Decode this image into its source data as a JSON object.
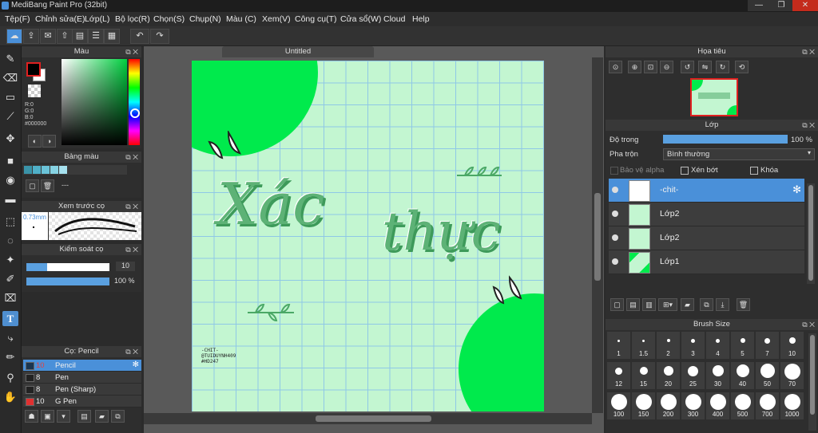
{
  "window": {
    "title": "MediBang Paint Pro (32bit)",
    "min": "—",
    "max": "❐",
    "close": "✕"
  },
  "menu": [
    "Tệp(F)",
    "Chỉnh sửa(E)",
    "Lớp(L)",
    "Bộ lọc(R)",
    "Chọn(S)",
    "Chụp(N)",
    "Màu (C)",
    "Xem(V)",
    "Công cụ(T)",
    "Cửa sổ(W)",
    "Cloud",
    "Help"
  ],
  "color_panel": {
    "title": "Màu",
    "r": "R:0",
    "g": "G:0",
    "b": "B:0",
    "hex": "#000000"
  },
  "palette_panel": {
    "title": "Bảng màu",
    "swatches": [
      "#3a93a8",
      "#4fb0c8",
      "#6ac3d8",
      "#86d3e3",
      "#a6e1ee"
    ],
    "value": "---"
  },
  "brush_preview": {
    "title": "Xem trước cọ",
    "size": "0.73mm"
  },
  "brush_control": {
    "title": "Kiểm soát cọ",
    "size_value": "10",
    "opacity_value": "100 %",
    "size_fill": 0.25,
    "opacity_fill": 1.0
  },
  "brush_list": {
    "title": "Cọ: Pencil",
    "items": [
      {
        "size": "10",
        "name": "Pencil",
        "color": "#1a3550",
        "selected": true
      },
      {
        "size": "8",
        "name": "Pen",
        "color": "#222222",
        "selected": false
      },
      {
        "size": "8",
        "name": "Pen (Sharp)",
        "color": "#222222",
        "selected": false
      },
      {
        "size": "10",
        "name": "G Pen",
        "color": "#e03030",
        "selected": false
      }
    ]
  },
  "document": {
    "tab": "Untitled",
    "text_line1": "Xác",
    "text_line2": "thực",
    "signature": [
      "-CHIT-",
      "@TUIDUYNH409",
      "#HD247"
    ]
  },
  "navigator": {
    "title": "Họa tiêu"
  },
  "layers": {
    "title": "Lớp",
    "opacity_label": "Độ trong",
    "opacity_value": "100 %",
    "opacity_fill": 1.0,
    "blend_label": "Pha trộn",
    "blend_value": "Bình thường",
    "protect_alpha": "Bảo vệ alpha",
    "clipping": "Xén bớt",
    "lock": "Khóa",
    "items": [
      {
        "name": "-chit-",
        "selected": true
      },
      {
        "name": "Lớp2",
        "selected": false
      },
      {
        "name": "Lớp2",
        "selected": false
      },
      {
        "name": "Lớp1",
        "selected": false
      }
    ]
  },
  "brush_size_panel": {
    "title": "Brush Size",
    "sizes": [
      "1",
      "1.5",
      "2",
      "3",
      "4",
      "5",
      "7",
      "10",
      "12",
      "15",
      "20",
      "25",
      "30",
      "40",
      "50",
      "70",
      "100",
      "150",
      "200",
      "300",
      "400",
      "500",
      "700",
      "1000"
    ]
  },
  "colors": {
    "accent": "#4a90d9",
    "canvas_bg": "#c3f6d1",
    "circle": "#00ea4c",
    "text_green": "#5db276"
  }
}
